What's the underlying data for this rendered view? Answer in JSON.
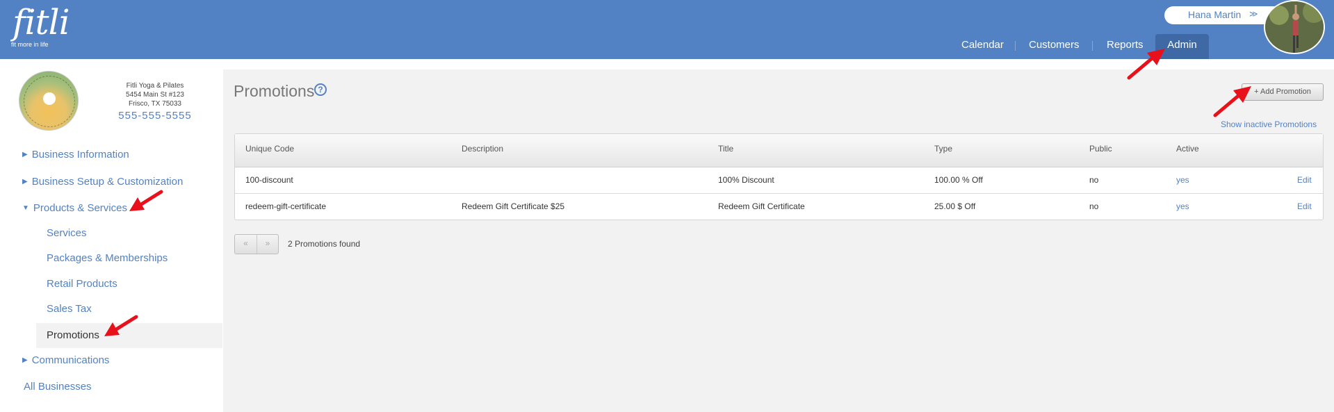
{
  "brand": {
    "logo_text": "fitli",
    "tagline": "fit more in life"
  },
  "user": {
    "name": "Hana Martin"
  },
  "nav": [
    "Calendar",
    "Customers",
    "Reports",
    "Admin"
  ],
  "business": {
    "name": "Fitli Yoga & Pilates",
    "address1": "5454 Main St #123",
    "address2": "Frisco, TX 75033",
    "phone": "555-555-5555"
  },
  "sidebar": {
    "business_information": "Business Information",
    "business_setup": "Business Setup & Customization",
    "products_services": "Products & Services",
    "sub": [
      "Services",
      "Packages & Memberships",
      "Retail Products",
      "Sales Tax",
      "Promotions"
    ],
    "communications": "Communications",
    "all_businesses": "All Businesses"
  },
  "page": {
    "title": "Promotions",
    "help": "?",
    "add_button": "+ Add Promotion",
    "show_inactive": "Show inactive Promotions",
    "found": "2 Promotions found",
    "pager_prev": "«",
    "pager_next": "»"
  },
  "table": {
    "headers": [
      "Unique Code",
      "Description",
      "Title",
      "Type",
      "Public",
      "Active"
    ],
    "rows": [
      {
        "code": "100-discount",
        "description": "",
        "title": "100% Discount",
        "type": "100.00 % Off",
        "public": "no",
        "active": "yes",
        "edit": "Edit"
      },
      {
        "code": "redeem-gift-certificate",
        "description": "Redeem Gift Certificate $25",
        "title": "Redeem Gift Certificate",
        "type": "25.00 $ Off",
        "public": "no",
        "active": "yes",
        "edit": "Edit"
      }
    ]
  },
  "colors": {
    "header_bg": "#5282c4",
    "admin_tab": "#3e69a5",
    "link": "#5282c4",
    "annotation": "#e8101a"
  }
}
